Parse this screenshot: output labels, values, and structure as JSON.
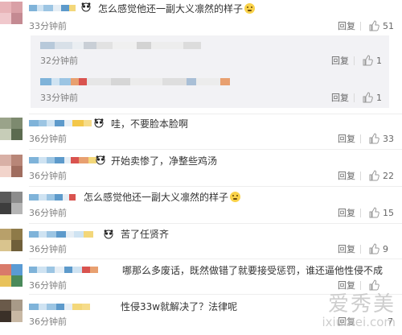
{
  "comments": [
    {
      "text": "怎么感觉他还一副大义凛然的样子",
      "time": "33分钟前",
      "reply": "回复",
      "likes": "51",
      "avatar": [
        "#e8b4b8",
        "#d9a0a6",
        "#f0c8cc",
        "#c48a92"
      ]
    },
    {
      "text": "",
      "time": "32分钟前",
      "reply": "回复",
      "likes": "1",
      "sub": true
    },
    {
      "text": "",
      "time": "33分钟前",
      "reply": "回复",
      "likes": "1",
      "sub2": true
    },
    {
      "text": "哇，不要脸本脸啊",
      "time": "36分钟前",
      "reply": "回复",
      "likes": "33",
      "avatar": [
        "#9aa38a",
        "#7d8a6f",
        "#c7cdb8",
        "#5c6b50"
      ]
    },
    {
      "text": "开始卖惨了，净整些鸡汤",
      "time": "36分钟前",
      "reply": "回复",
      "likes": "22",
      "avatar": [
        "#d8b0a6",
        "#b88678",
        "#f2d4cb",
        "#a06d5f"
      ]
    },
    {
      "text": "怎么感觉他还一副大义凛然的样子",
      "time": "36分钟前",
      "reply": "回复",
      "likes": "15",
      "avatar": [
        "#5a5a5a",
        "#8c8c8c",
        "#3d3d3d",
        "#b5b5b5"
      ]
    },
    {
      "text": "苦了任贤齐",
      "time": "36分钟前",
      "reply": "回复",
      "likes": "9",
      "avatar": [
        "#b8a06a",
        "#8e7a48",
        "#d9c48e",
        "#6f5f3a"
      ]
    },
    {
      "text": "哪那么多废话，既然做错了就要接受惩罚，谁还逼他性侵不成",
      "time": "36分钟前",
      "reply": "回复",
      "likes": "",
      "avatar": [
        "#d97a6a",
        "#5a9bd4",
        "#e8c25a",
        "#4a8a5a"
      ]
    },
    {
      "text": "性侵33w就解决了？法律呢",
      "time": "36分钟前",
      "reply": "回复",
      "likes": "7",
      "avatar": [
        "#6a5a4a",
        "#a89a88",
        "#3a3028",
        "#c8b8a4"
      ]
    }
  ],
  "icons": {
    "like": "thumbs-up-icon",
    "emoji": "emoji-icon",
    "panda": "panda-icon"
  },
  "watermark": {
    "cn": "爱秀美",
    "en": "ixiumei.com"
  }
}
